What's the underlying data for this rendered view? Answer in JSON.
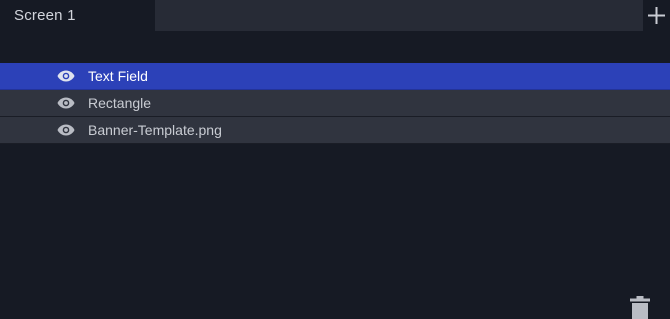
{
  "tabs": {
    "active_label": "Screen 1",
    "add_icon": "plus-icon"
  },
  "layers": [
    {
      "label": "Text Field",
      "selected": true,
      "icon": "eye-icon"
    },
    {
      "label": "Rectangle",
      "selected": false,
      "icon": "eye-icon"
    },
    {
      "label": "Banner-Template.png",
      "selected": false,
      "icon": "eye-icon"
    }
  ],
  "footer": {
    "delete_icon": "trash-icon"
  },
  "colors": {
    "background": "#161a24",
    "tab_empty": "#272b36",
    "row": "#30343f",
    "selected_row": "#2c41b8",
    "text": "#c9ccd3"
  }
}
